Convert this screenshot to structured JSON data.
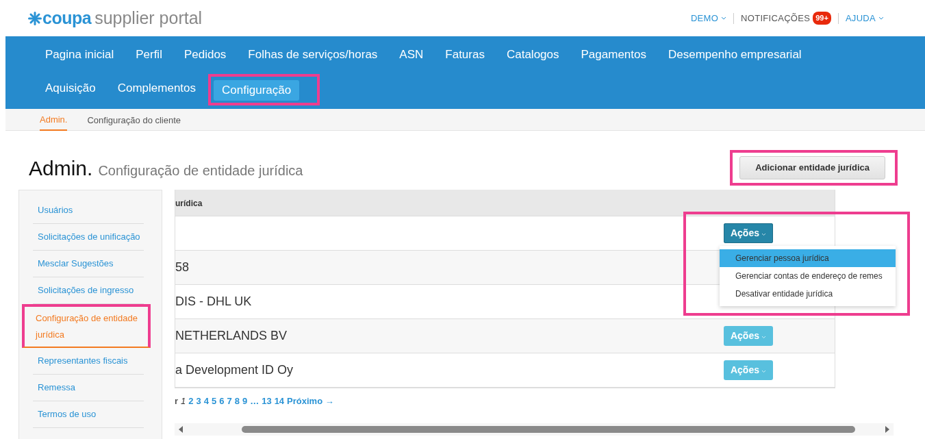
{
  "logo": {
    "brand": "coupa",
    "product": "supplier portal"
  },
  "top_links": [
    {
      "label": "DEMO",
      "kind": "dropdown"
    },
    {
      "label": "NOTIFICAÇÕES",
      "kind": "badge",
      "badge": "99+"
    },
    {
      "label": "AJUDA",
      "kind": "dropdown"
    }
  ],
  "main_nav": [
    {
      "label": "Pagina inicial",
      "selected": false,
      "highlighted": false
    },
    {
      "label": "Perfil",
      "selected": false,
      "highlighted": false
    },
    {
      "label": "Pedidos",
      "selected": false,
      "highlighted": false
    },
    {
      "label": "Folhas de serviços/horas",
      "selected": false,
      "highlighted": false
    },
    {
      "label": "ASN",
      "selected": false,
      "highlighted": false
    },
    {
      "label": "Faturas",
      "selected": false,
      "highlighted": false
    },
    {
      "label": "Catalogos",
      "selected": false,
      "highlighted": false
    },
    {
      "label": "Pagamentos",
      "selected": false,
      "highlighted": false
    },
    {
      "label": "Desempenho empresarial",
      "selected": false,
      "highlighted": false
    },
    {
      "label": "Aquisição",
      "selected": false,
      "highlighted": false
    },
    {
      "label": "Complementos",
      "selected": false,
      "highlighted": false
    },
    {
      "label": "Configuração",
      "selected": true,
      "highlighted": true
    }
  ],
  "sub_nav": [
    {
      "label": "Admin.",
      "selected": true
    },
    {
      "label": "Configuração do cliente",
      "selected": false
    }
  ],
  "page_title": {
    "section": "Admin.",
    "subtitle": "Configuração de entidade jurídica"
  },
  "add_button": {
    "label": "Adicionar entidade jurídica",
    "highlighted": true
  },
  "sidebar": [
    {
      "label": "Usuários",
      "selected": false,
      "highlighted": false
    },
    {
      "label": "Solicitações de unificação",
      "selected": false,
      "highlighted": false
    },
    {
      "label": "Mesclar Sugestões",
      "selected": false,
      "highlighted": false
    },
    {
      "label": "Solicitações de ingresso",
      "selected": false,
      "highlighted": false
    },
    {
      "label": "Configuração de entidade jurídica",
      "selected": true,
      "highlighted": true
    },
    {
      "label": "Representantes fiscais",
      "selected": false,
      "highlighted": false
    },
    {
      "label": "Remessa",
      "selected": false,
      "highlighted": false
    },
    {
      "label": "Termos de uso",
      "selected": false,
      "highlighted": false
    }
  ],
  "table": {
    "columns": [
      "urídica"
    ],
    "rows": [
      {
        "name": "",
        "action": "Ações",
        "active": true
      },
      {
        "name": "58"
      },
      {
        "name": "DIS - DHL UK"
      },
      {
        "name": "NETHERLANDS BV",
        "action": "Ações",
        "active": false
      },
      {
        "name": "a Development ID Oy",
        "action": "Ações",
        "active": false
      }
    ]
  },
  "actions_menu": {
    "highlighted": true,
    "items": [
      {
        "label": "Gerenciar pessoa jurídica",
        "selected": true
      },
      {
        "label": "Gerenciar contas de endereço de remes",
        "selected": false
      },
      {
        "label": "Desativar entidade jurídica",
        "selected": false
      }
    ]
  },
  "pagination": {
    "previous": "r",
    "pages": [
      {
        "label": "1",
        "selected": true
      },
      {
        "label": "2",
        "selected": false
      },
      {
        "label": "3",
        "selected": false
      },
      {
        "label": "4",
        "selected": false
      },
      {
        "label": "5",
        "selected": false
      },
      {
        "label": "6",
        "selected": false
      },
      {
        "label": "7",
        "selected": false
      },
      {
        "label": "8",
        "selected": false
      },
      {
        "label": "9",
        "selected": false
      },
      {
        "label": "…",
        "selected": false
      },
      {
        "label": "13",
        "selected": false
      },
      {
        "label": "14",
        "selected": false
      }
    ],
    "next": "Próximo →"
  }
}
